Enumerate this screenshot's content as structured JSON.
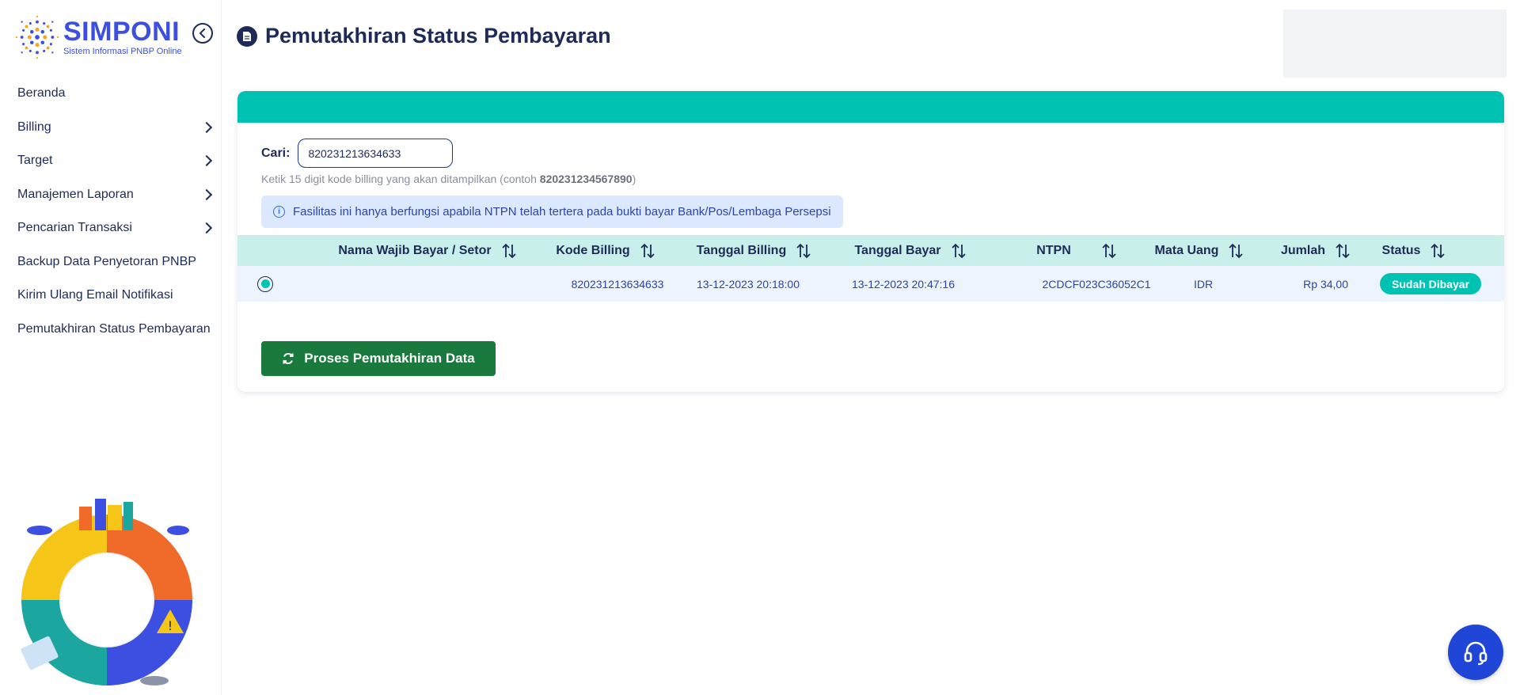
{
  "brand": {
    "name": "SIMPONI",
    "subtitle": "Sistem Informasi PNBP Online",
    "color": "#3d4fe0"
  },
  "sidebar": {
    "items": [
      {
        "label": "Beranda",
        "has_submenu": false
      },
      {
        "label": "Billing",
        "has_submenu": true
      },
      {
        "label": "Target",
        "has_submenu": true
      },
      {
        "label": "Manajemen Laporan",
        "has_submenu": true
      },
      {
        "label": "Pencarian Transaksi",
        "has_submenu": true
      },
      {
        "label": "Backup Data Penyetoran PNBP",
        "has_submenu": false
      },
      {
        "label": "Kirim Ulang Email Notifikasi",
        "has_submenu": false
      },
      {
        "label": "Pemutakhiran Status Pembayaran",
        "has_submenu": false
      }
    ]
  },
  "page": {
    "title": "Pemutakhiran Status Pembayaran",
    "icon": "document-icon"
  },
  "search": {
    "label": "Cari:",
    "value": "820231213634633",
    "hint_prefix": "Ketik 15 digit kode billing yang akan ditampilkan (contoh ",
    "hint_example": "820231234567890",
    "hint_suffix": ")"
  },
  "info": {
    "text": "Fasilitas ini hanya berfungsi apabila NTPN telah tertera pada bukti bayar Bank/Pos/Lembaga Persepsi"
  },
  "table": {
    "headers": [
      "Nama Wajib Bayar / Setor",
      "Kode Billing",
      "Tanggal Billing",
      "Tanggal Bayar",
      "NTPN",
      "Mata Uang",
      "Jumlah",
      "Status"
    ],
    "rows": [
      {
        "selected": true,
        "nama": "",
        "kode_billing": "820231213634633",
        "tanggal_billing": "13-12-2023 20:18:00",
        "tanggal_bayar": "13-12-2023 20:47:16",
        "ntpn": "2CDCF023C36052C1",
        "mata_uang": "IDR",
        "jumlah": "Rp 34,00",
        "status": "Sudah Dibayar"
      }
    ]
  },
  "actions": {
    "process_label": "Proses Pemutakhiran Data"
  },
  "colors": {
    "primary_navy": "#1e2b58",
    "teal": "#00c2b2",
    "green_button": "#1a7a3d",
    "help_blue": "#2046d8"
  }
}
